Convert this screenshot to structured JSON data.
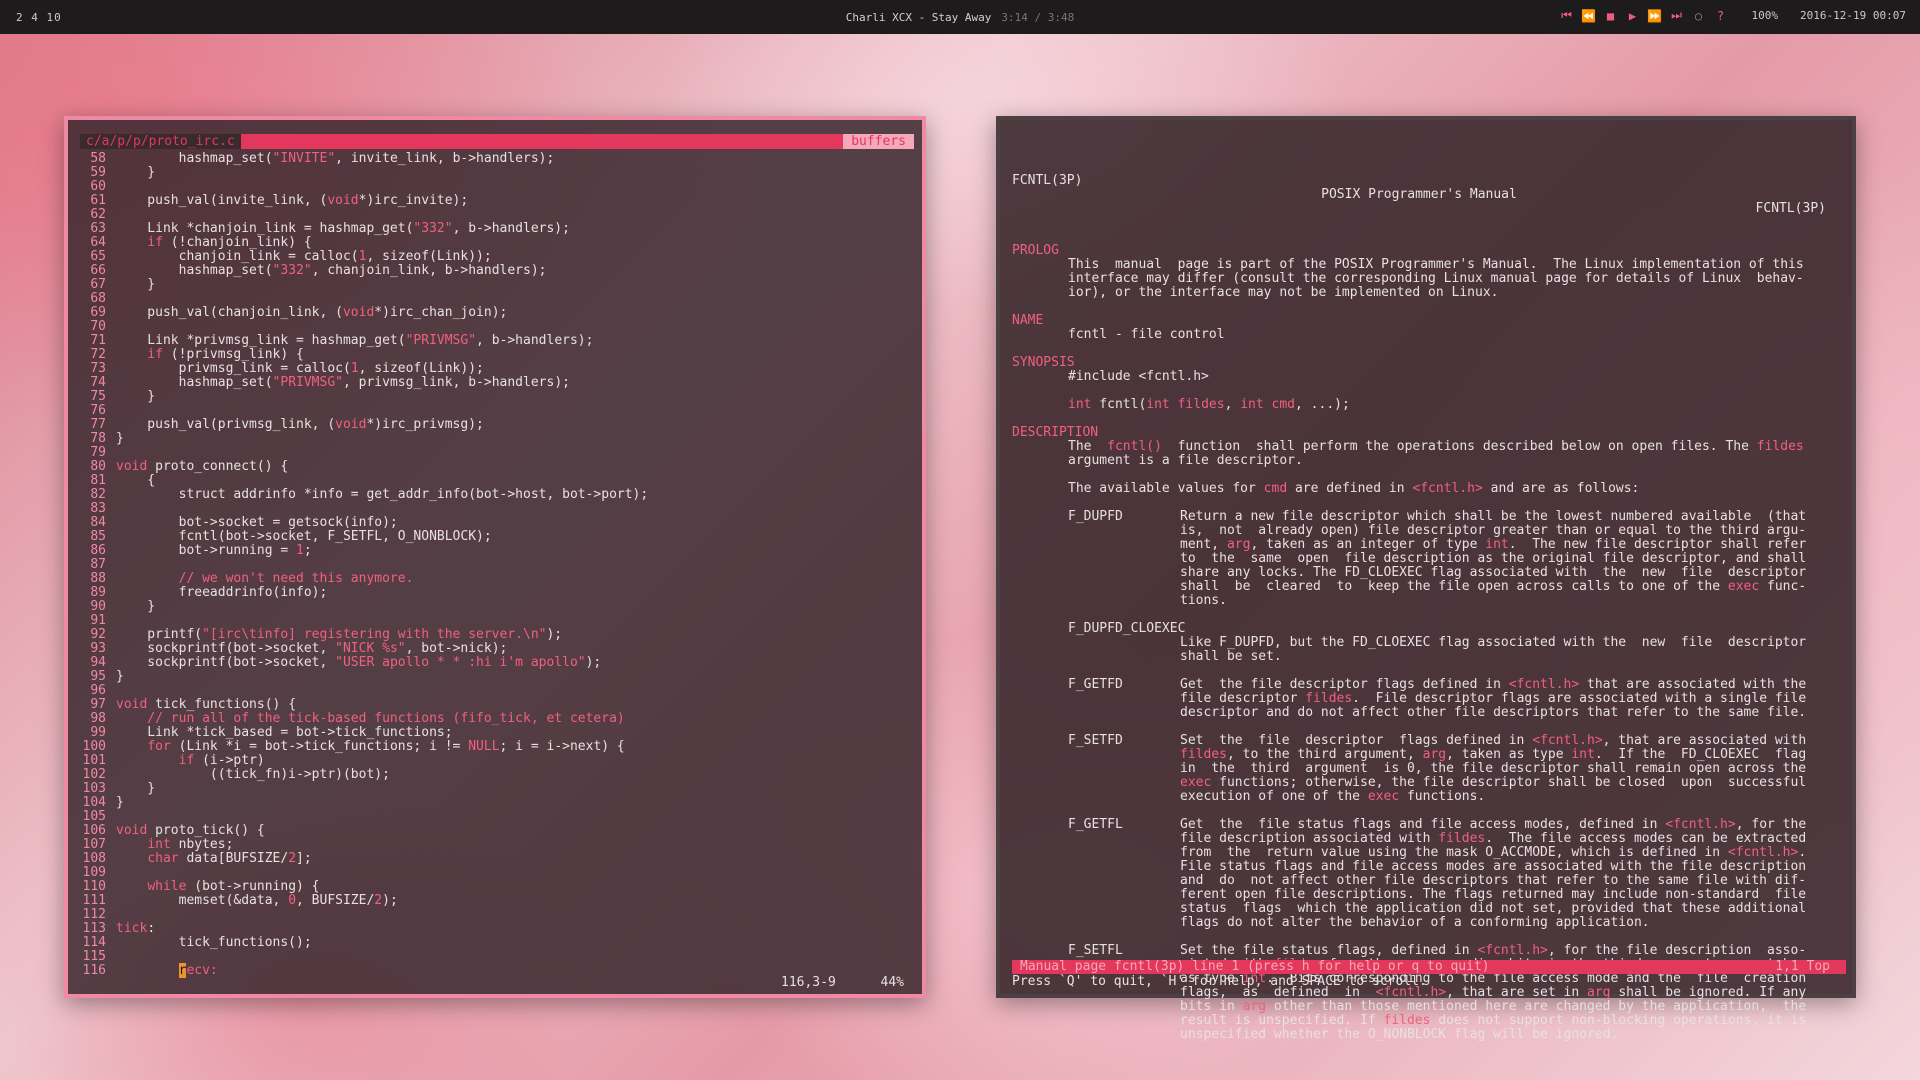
{
  "topbar": {
    "workspaces": "2 4 10",
    "track": "Charli XCX - Stay Away",
    "time": "3:14 / 3:48",
    "volume": "100%",
    "datetime": "2016-12-19 00:07",
    "controls": [
      "first-icon",
      "prev-icon",
      "stop-icon",
      "play-icon",
      "next-icon",
      "last-icon",
      "repeat-icon",
      "help-icon"
    ]
  },
  "editor": {
    "file_tab": "c/a/p/p/proto_irc.c",
    "buffers_tab": "buffers",
    "position": "116,3-9",
    "percent": "44%"
  },
  "man": {
    "header_left": "FCNTL(3P)",
    "header_center": "POSIX Programmer's Manual",
    "header_right": "FCNTL(3P)",
    "status_left": "Manual page fcntl(3p) line 1 (press h for help or q to quit)",
    "status_right": "1,1  Top",
    "prompt": "Press `Q' to quit, `H' for help, and SPACE to scroll."
  },
  "colors": {
    "accent": "#f08aa4",
    "keyword": "#f0607f",
    "statusbar": "#e4375c",
    "cursor": "#f0922e"
  },
  "code_lines": [
    {
      "n": "58",
      "t": "        hashmap_set(\"INVITE\", invite_link, b->handlers);"
    },
    {
      "n": "59",
      "t": "    }"
    },
    {
      "n": "60",
      "t": ""
    },
    {
      "n": "61",
      "t": "    push_val(invite_link, (void*)irc_invite);"
    },
    {
      "n": "62",
      "t": ""
    },
    {
      "n": "63",
      "t": "    Link *chanjoin_link = hashmap_get(\"332\", b->handlers);"
    },
    {
      "n": "64",
      "t": "    if (!chanjoin_link) {"
    },
    {
      "n": "65",
      "t": "        chanjoin_link = calloc(1, sizeof(Link));"
    },
    {
      "n": "66",
      "t": "        hashmap_set(\"332\", chanjoin_link, b->handlers);"
    },
    {
      "n": "67",
      "t": "    }"
    },
    {
      "n": "68",
      "t": ""
    },
    {
      "n": "69",
      "t": "    push_val(chanjoin_link, (void*)irc_chan_join);"
    },
    {
      "n": "70",
      "t": ""
    },
    {
      "n": "71",
      "t": "    Link *privmsg_link = hashmap_get(\"PRIVMSG\", b->handlers);"
    },
    {
      "n": "72",
      "t": "    if (!privmsg_link) {"
    },
    {
      "n": "73",
      "t": "        privmsg_link = calloc(1, sizeof(Link));"
    },
    {
      "n": "74",
      "t": "        hashmap_set(\"PRIVMSG\", privmsg_link, b->handlers);"
    },
    {
      "n": "75",
      "t": "    }"
    },
    {
      "n": "76",
      "t": ""
    },
    {
      "n": "77",
      "t": "    push_val(privmsg_link, (void*)irc_privmsg);"
    },
    {
      "n": "78",
      "t": "}"
    },
    {
      "n": "79",
      "t": ""
    },
    {
      "n": "80",
      "t": "void proto_connect() {"
    },
    {
      "n": "81",
      "t": "    {"
    },
    {
      "n": "82",
      "t": "        struct addrinfo *info = get_addr_info(bot->host, bot->port);"
    },
    {
      "n": "83",
      "t": ""
    },
    {
      "n": "84",
      "t": "        bot->socket = getsock(info);"
    },
    {
      "n": "85",
      "t": "        fcntl(bot->socket, F_SETFL, O_NONBLOCK);"
    },
    {
      "n": "86",
      "t": "        bot->running = 1;"
    },
    {
      "n": "87",
      "t": ""
    },
    {
      "n": "88",
      "t": "        // we won't need this anymore."
    },
    {
      "n": "89",
      "t": "        freeaddrinfo(info);"
    },
    {
      "n": "90",
      "t": "    }"
    },
    {
      "n": "91",
      "t": ""
    },
    {
      "n": "92",
      "t": "    printf(\"[irc\\tinfo] registering with the server.\\n\");"
    },
    {
      "n": "93",
      "t": "    sockprintf(bot->socket, \"NICK %s\", bot->nick);"
    },
    {
      "n": "94",
      "t": "    sockprintf(bot->socket, \"USER apollo * * :hi i'm apollo\");"
    },
    {
      "n": "95",
      "t": "}"
    },
    {
      "n": "96",
      "t": ""
    },
    {
      "n": "97",
      "t": "void tick_functions() {"
    },
    {
      "n": "98",
      "t": "    // run all of the tick-based functions (fifo_tick, et cetera)"
    },
    {
      "n": "99",
      "t": "    Link *tick_based = bot->tick_functions;"
    },
    {
      "n": "100",
      "t": "    for (Link *i = bot->tick_functions; i != NULL; i = i->next) {"
    },
    {
      "n": "101",
      "t": "        if (i->ptr)"
    },
    {
      "n": "102",
      "t": "            ((tick_fn)i->ptr)(bot);"
    },
    {
      "n": "103",
      "t": "    }"
    },
    {
      "n": "104",
      "t": "}"
    },
    {
      "n": "105",
      "t": ""
    },
    {
      "n": "106",
      "t": "void proto_tick() {"
    },
    {
      "n": "107",
      "t": "    int nbytes;"
    },
    {
      "n": "108",
      "t": "    char data[BUFSIZE/2];"
    },
    {
      "n": "109",
      "t": ""
    },
    {
      "n": "110",
      "t": "    while (bot->running) {"
    },
    {
      "n": "111",
      "t": "        memset(&data, 0, BUFSIZE/2);"
    },
    {
      "n": "112",
      "t": ""
    },
    {
      "n": "113",
      "t": "tick:"
    },
    {
      "n": "114",
      "t": "        tick_functions();"
    },
    {
      "n": "115",
      "t": ""
    },
    {
      "n": "116",
      "t": "        recv:"
    }
  ],
  "man_lines": [
    {
      "k": "sec",
      "t": "PROLOG"
    },
    {
      "k": "i1",
      "t": "This  manual  page is part of the POSIX Programmer's Manual.  The Linux implementation of this"
    },
    {
      "k": "i1",
      "t": "interface may differ (consult the corresponding Linux manual page for details of Linux  behav-"
    },
    {
      "k": "i1",
      "t": "ior), or the interface may not be implemented on Linux."
    },
    {
      "k": "blank",
      "t": ""
    },
    {
      "k": "sec",
      "t": "NAME"
    },
    {
      "k": "i1",
      "t": "fcntl - file control"
    },
    {
      "k": "blank",
      "t": ""
    },
    {
      "k": "sec",
      "t": "SYNOPSIS"
    },
    {
      "k": "i1",
      "t": "#include <fcntl.h>"
    },
    {
      "k": "blank",
      "t": ""
    },
    {
      "k": "i1",
      "t": "int fcntl(int fildes, int cmd, ...);"
    },
    {
      "k": "blank",
      "t": ""
    },
    {
      "k": "sec",
      "t": "DESCRIPTION"
    },
    {
      "k": "i1",
      "t": "The  fcntl()  function  shall perform the operations described below on open files. The fildes"
    },
    {
      "k": "i1",
      "t": "argument is a file descriptor."
    },
    {
      "k": "blank",
      "t": ""
    },
    {
      "k": "i1",
      "t": "The available values for cmd are defined in <fcntl.h> and are as follows:"
    },
    {
      "k": "blank",
      "t": ""
    },
    {
      "k": "opt",
      "o": "F_DUPFD",
      "t": "Return a new file descriptor which shall be the lowest numbered available  (that"
    },
    {
      "k": "i2",
      "t": "is,  not  already open) file descriptor greater than or equal to the third argu-"
    },
    {
      "k": "i2",
      "t": "ment, arg, taken as an integer of type int.  The new file descriptor shall refer"
    },
    {
      "k": "i2",
      "t": "to  the  same  open  file description as the original file descriptor, and shall"
    },
    {
      "k": "i2",
      "t": "share any locks. The FD_CLOEXEC flag associated with  the  new  file  descriptor"
    },
    {
      "k": "i2",
      "t": "shall  be  cleared  to  keep the file open across calls to one of the exec func-"
    },
    {
      "k": "i2",
      "t": "tions."
    },
    {
      "k": "blank",
      "t": ""
    },
    {
      "k": "i1",
      "t": "F_DUPFD_CLOEXEC"
    },
    {
      "k": "i2",
      "t": "Like F_DUPFD, but the FD_CLOEXEC flag associated with the  new  file  descriptor"
    },
    {
      "k": "i2",
      "t": "shall be set."
    },
    {
      "k": "blank",
      "t": ""
    },
    {
      "k": "opt",
      "o": "F_GETFD",
      "t": "Get  the file descriptor flags defined in <fcntl.h> that are associated with the"
    },
    {
      "k": "i2",
      "t": "file descriptor fildes.  File descriptor flags are associated with a single file"
    },
    {
      "k": "i2",
      "t": "descriptor and do not affect other file descriptors that refer to the same file."
    },
    {
      "k": "blank",
      "t": ""
    },
    {
      "k": "opt",
      "o": "F_SETFD",
      "t": "Set  the  file  descriptor  flags defined in <fcntl.h>, that are associated with"
    },
    {
      "k": "i2",
      "t": "fildes, to the third argument, arg, taken as type int.  If the  FD_CLOEXEC  flag"
    },
    {
      "k": "i2",
      "t": "in  the  third  argument  is 0, the file descriptor shall remain open across the"
    },
    {
      "k": "i2",
      "t": "exec functions; otherwise, the file descriptor shall be closed  upon  successful"
    },
    {
      "k": "i2",
      "t": "execution of one of the exec functions."
    },
    {
      "k": "blank",
      "t": ""
    },
    {
      "k": "opt",
      "o": "F_GETFL",
      "t": "Get  the  file status flags and file access modes, defined in <fcntl.h>, for the"
    },
    {
      "k": "i2",
      "t": "file description associated with fildes.  The file access modes can be extracted"
    },
    {
      "k": "i2",
      "t": "from  the  return value using the mask O_ACCMODE, which is defined in <fcntl.h>."
    },
    {
      "k": "i2",
      "t": "File status flags and file access modes are associated with the file description"
    },
    {
      "k": "i2",
      "t": "and  do  not affect other file descriptors that refer to the same file with dif-"
    },
    {
      "k": "i2",
      "t": "ferent open file descriptions. The flags returned may include non-standard  file"
    },
    {
      "k": "i2",
      "t": "status  flags  which the application did not set, provided that these additional"
    },
    {
      "k": "i2",
      "t": "flags do not alter the behavior of a conforming application."
    },
    {
      "k": "blank",
      "t": ""
    },
    {
      "k": "opt",
      "o": "F_SETFL",
      "t": "Set the file status flags, defined in <fcntl.h>, for the file description  asso-"
    },
    {
      "k": "i2",
      "t": "ciated with fildes from the corresponding bits in the third argument, arg, taken"
    },
    {
      "k": "i2",
      "t": "as type int.  Bits corresponding to the file access mode and the  file  creation"
    },
    {
      "k": "i2",
      "t": "flags,  as  defined  in  <fcntl.h>, that are set in arg shall be ignored. If any"
    },
    {
      "k": "i2",
      "t": "bits in arg other than those mentioned here are changed by the application,  the"
    },
    {
      "k": "i2",
      "t": "result is unspecified. If fildes does not support non-blocking operations, it is"
    },
    {
      "k": "i2",
      "t": "unspecified whether the O_NONBLOCK flag will be ignored."
    }
  ]
}
